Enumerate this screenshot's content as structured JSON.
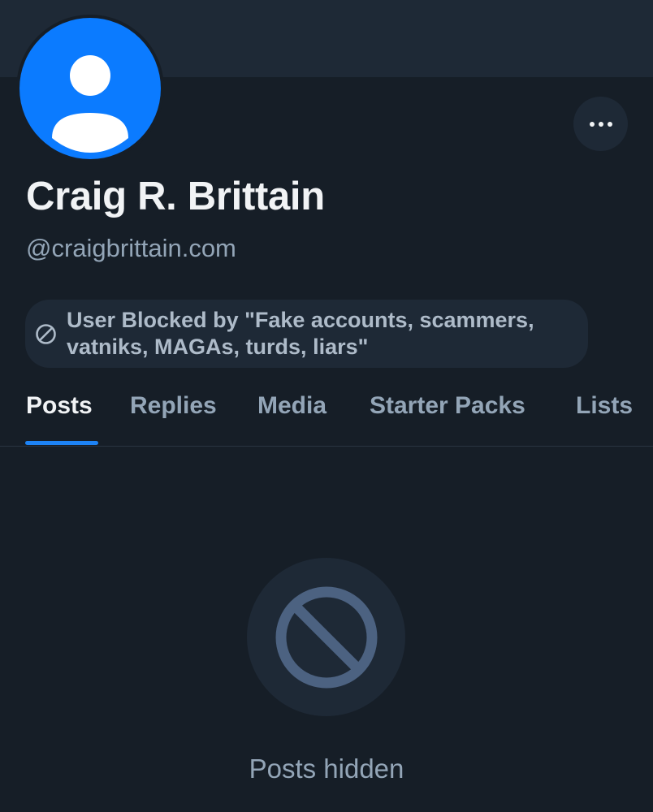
{
  "profile": {
    "display_name": "Craig R. Brittain",
    "handle": "@craigbrittain.com",
    "blocked_notice": "User Blocked by \"Fake accounts, scammers, vatniks, MAGAs, turds, liars\""
  },
  "tabs": [
    {
      "label": "Posts",
      "active": true
    },
    {
      "label": "Replies",
      "active": false
    },
    {
      "label": "Media",
      "active": false
    },
    {
      "label": "Starter Packs",
      "active": false
    },
    {
      "label": "Lists",
      "active": false
    }
  ],
  "empty_state": {
    "message": "Posts hidden",
    "icon": "ban-icon"
  },
  "icons": {
    "avatar": "default-user-avatar",
    "more": "more-horizontal-icon",
    "blocked": "ban-icon"
  },
  "colors": {
    "background": "#161e27",
    "surface": "#1e2936",
    "accent": "#1d83f5",
    "avatar_bg": "#0b7bff",
    "text_primary": "#f1f3f5",
    "text_secondary": "#93a5b7"
  }
}
